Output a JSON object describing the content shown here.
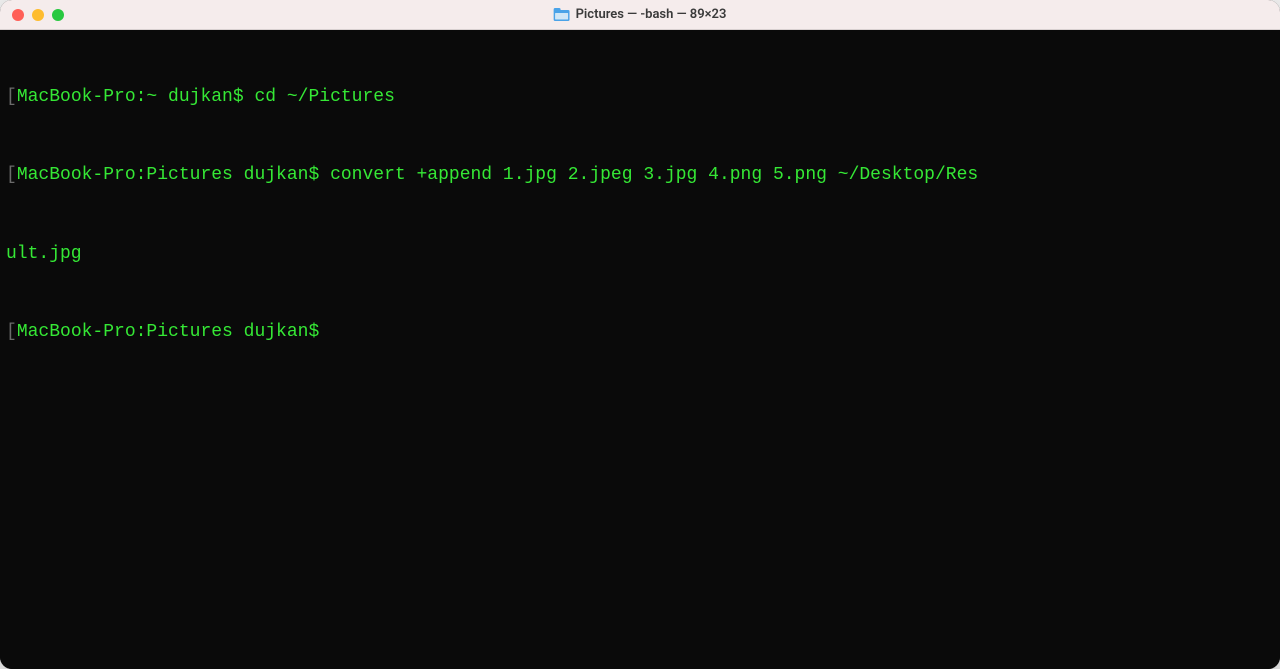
{
  "window": {
    "title": "Pictures — -bash — 89×23"
  },
  "terminal": {
    "lines": [
      {
        "open_bracket": "[",
        "prompt": "MacBook-Pro:~ dujkan$ ",
        "command": "cd ~/Pictures",
        "close_bracket": "]"
      },
      {
        "open_bracket": "[",
        "prompt": "MacBook-Pro:Pictures dujkan$ ",
        "command": "convert +append 1.jpg 2.jpeg 3.jpg 4.png 5.png ~/Desktop/Res",
        "close_bracket": "]"
      },
      {
        "continuation": "ult.jpg"
      },
      {
        "open_bracket": "[",
        "prompt": "MacBook-Pro:Pictures dujkan$ ",
        "command": ""
      }
    ]
  }
}
